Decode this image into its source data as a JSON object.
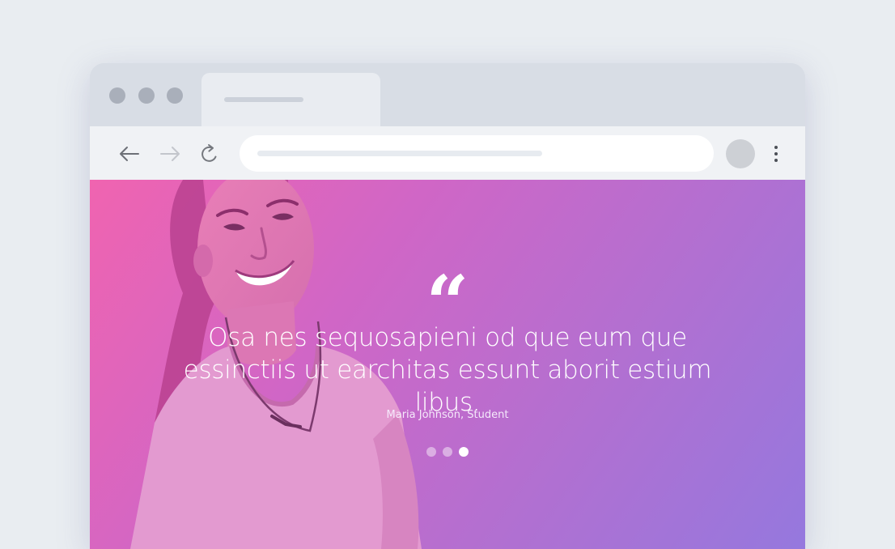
{
  "browser": {
    "traffic_lights": [
      "close",
      "minimize",
      "maximize"
    ],
    "tab": {
      "state": "active"
    },
    "nav": {
      "back_icon": "arrow-left-icon",
      "forward_icon": "arrow-right-icon",
      "reload_icon": "reload-icon",
      "menu_icon": "kebab-menu-icon"
    }
  },
  "testimonial": {
    "quote_mark": "“",
    "quote": "Osa nes sequosapieni od que eum que essinctiis ut earchitas essunt aborit estium libus.",
    "author": "Maria Johnson, Student",
    "slides": 3,
    "active_slide": 3
  },
  "colors": {
    "background": "#e9edf1",
    "gradient_start": "#f064b0",
    "gradient_end": "#9578de",
    "text": "#ffffff"
  }
}
